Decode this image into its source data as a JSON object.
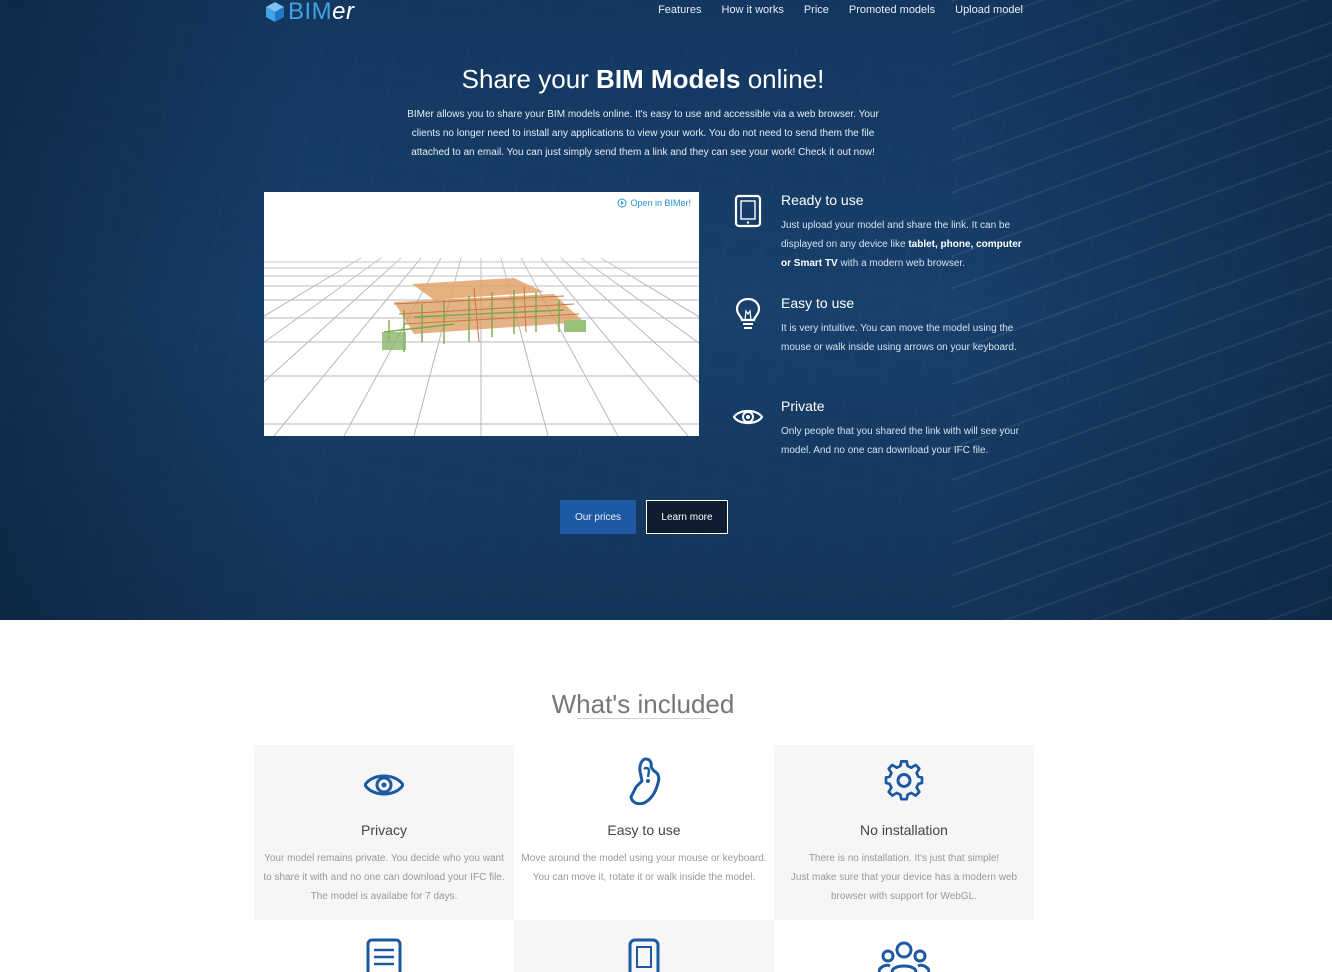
{
  "brand": {
    "logo_bim": "BIM",
    "logo_er": "er"
  },
  "nav": {
    "items": [
      "Features",
      "How it works",
      "Price",
      "Promoted models",
      "Upload model"
    ]
  },
  "hero": {
    "title_pre": "Share your ",
    "title_bold": "BIM Models",
    "title_post": " online!",
    "description": "BIMer allows you to share your BIM models online. It's easy to use and accessible via a web browser. Your clients no longer need to install any applications to view your work. You do not need to send them the file attached to an email. You can just simply send them a link and they can see your work! Check it out now!",
    "open_link": "Open in BIMer!",
    "features": [
      {
        "title": "Ready to use",
        "text_pre": "Just upload your model and share the link. It can be displayed on any device like ",
        "text_bold": "tablet, phone, computer or Smart TV",
        "text_post": " with a modern web browser.",
        "icon": "tablet-icon"
      },
      {
        "title": "Easy to use",
        "text": "It is very intuitive. You can move the model using the mouse or walk inside using arrows on your keyboard.",
        "icon": "lightbulb-icon"
      },
      {
        "title": "Private",
        "text": "Only people that you shared the link with will see your model. And no one can download your IFC file.",
        "icon": "eye-icon"
      }
    ],
    "btn_prices": "Our prices",
    "btn_learn": "Learn more"
  },
  "included": {
    "title": "What's included",
    "cards": [
      {
        "title": "Privacy",
        "text": "Your model remains private. You decide who you want to share it with and no one can download your IFC file. The model is availabe for 7 days.",
        "icon": "eye-icon"
      },
      {
        "title": "Easy to use",
        "text": "Move around the model using your mouse or keyboard. You can move it, rotate it or walk inside the model.",
        "icon": "pointing-hand-icon"
      },
      {
        "title": "No installation",
        "text": "There is no installation. It's just that simple!\nJust make sure that your device has a modern web browser with support for WebGL.",
        "icon": "gear-icon"
      }
    ],
    "second_row_icons": [
      "document-icon",
      "phone-icon",
      "users-icon"
    ]
  },
  "colors": {
    "accent": "#1e5aa3",
    "icon_blue": "#1d58a2",
    "hero_bg": "#1d4a78",
    "logo_blue": "#3fa3e6"
  }
}
